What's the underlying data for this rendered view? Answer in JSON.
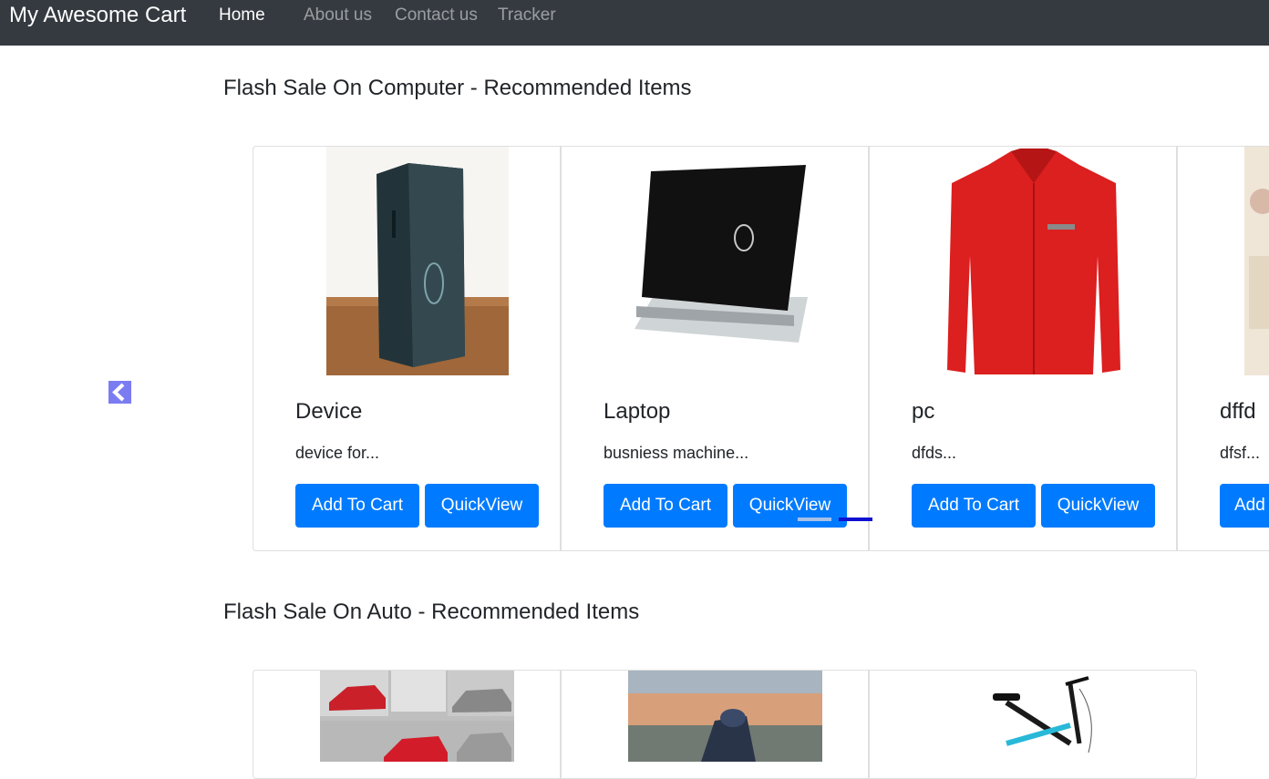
{
  "navbar": {
    "brand": "My Awesome Cart",
    "links": [
      "Home",
      "About us",
      "Contact us",
      "Tracker"
    ]
  },
  "sections": [
    {
      "title": "Flash Sale On Computer - Recommended Items",
      "products": [
        {
          "name": "Device",
          "desc": "device for...",
          "add_label": "Add To Cart",
          "view_label": "QuickView",
          "image": "mini-pc-photo"
        },
        {
          "name": "Laptop",
          "desc": "busniess machine...",
          "add_label": "Add To Cart",
          "view_label": "QuickView",
          "image": "laptop-photo"
        },
        {
          "name": "pc",
          "desc": "dfds...",
          "add_label": "Add To Cart",
          "view_label": "QuickView",
          "image": "red-shirt-photo"
        },
        {
          "name": "dffd",
          "desc": "dfsf...",
          "add_label": "Add",
          "image": "partial-photo"
        }
      ]
    },
    {
      "title": "Flash Sale On Auto - Recommended Items",
      "products": [
        {
          "image": "sports-cars-collage-photo"
        },
        {
          "image": "motorcycle-photo"
        },
        {
          "image": "bicycle-photo"
        }
      ]
    }
  ],
  "carousel": {
    "prev_icon": "chevron-left-icon"
  },
  "colors": {
    "navbar": "#343a40",
    "primary": "#007bff",
    "control": "#7c7cf2"
  }
}
